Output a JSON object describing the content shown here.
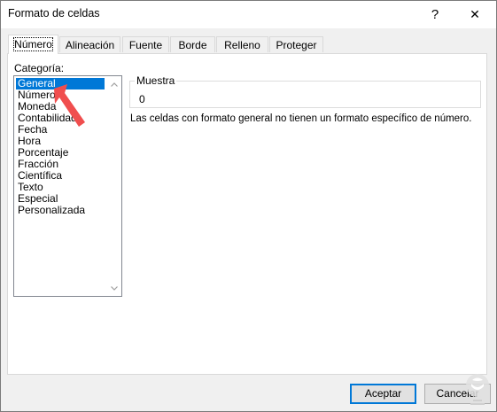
{
  "window": {
    "title": "Formato de celdas",
    "help_glyph": "?",
    "close_glyph": "✕"
  },
  "tabs": [
    {
      "label": "Número",
      "active": true
    },
    {
      "label": "Alineación",
      "active": false
    },
    {
      "label": "Fuente",
      "active": false
    },
    {
      "label": "Borde",
      "active": false
    },
    {
      "label": "Relleno",
      "active": false
    },
    {
      "label": "Proteger",
      "active": false
    }
  ],
  "category": {
    "label": "Categoría:",
    "items": [
      "General",
      "Número",
      "Moneda",
      "Contabilidad",
      "Fecha",
      "Hora",
      "Porcentaje",
      "Fracción",
      "Científica",
      "Texto",
      "Especial",
      "Personalizada"
    ],
    "selected_index": 0
  },
  "sample": {
    "label": "Muestra",
    "value": "0"
  },
  "description": "Las celdas con formato general no tienen un formato específico de número.",
  "buttons": {
    "ok": "Aceptar",
    "cancel": "Cancelar"
  },
  "colors": {
    "selection": "#0078d7",
    "annotation_arrow": "#f04e4e",
    "dialog_bg": "#f0f0f0"
  },
  "icons": {
    "scroll_up": "chevron-up-icon",
    "scroll_down": "chevron-down-icon",
    "annotation": "red-arrow-icon",
    "watermark": "watermark-logo-icon"
  }
}
